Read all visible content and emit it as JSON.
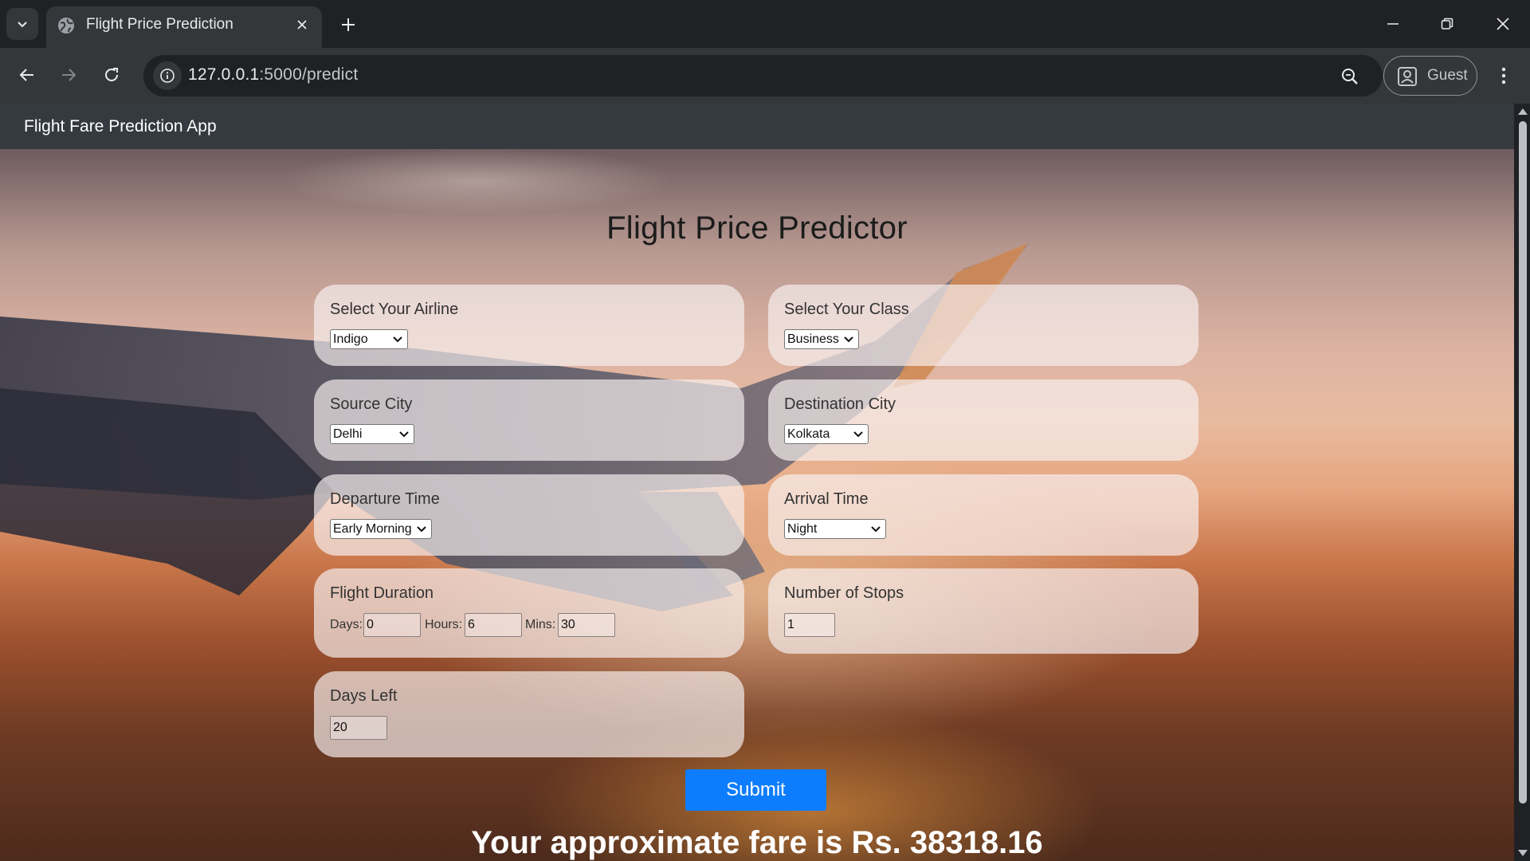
{
  "browser": {
    "tab_title": "Flight Price Prediction",
    "url_host": "127.0.0.1",
    "url_rest": ":5000/predict",
    "profile_label": "Guest"
  },
  "app": {
    "brand": "Flight Fare Prediction App",
    "title": "Flight Price Predictor",
    "fields": {
      "airline": {
        "label": "Select Your Airline",
        "value": "Indigo"
      },
      "class": {
        "label": "Select Your Class",
        "value": "Business"
      },
      "source": {
        "label": "Source City",
        "value": "Delhi"
      },
      "destination": {
        "label": "Destination City",
        "value": "Kolkata"
      },
      "departure": {
        "label": "Departure Time",
        "value": "Early Morning"
      },
      "arrival": {
        "label": "Arrival Time",
        "value": "Night"
      },
      "duration": {
        "label": "Flight Duration",
        "days_label": "Days:",
        "days_value": "0",
        "hours_label": "Hours:",
        "hours_value": "6",
        "mins_label": "Mins:",
        "mins_value": "30"
      },
      "stops": {
        "label": "Number of Stops",
        "value": "1"
      },
      "days_left": {
        "label": "Days Left",
        "value": "20"
      }
    },
    "submit_label": "Submit",
    "result": "Your approximate fare is Rs. 38318.16"
  },
  "colors": {
    "chrome_dark": "#202124",
    "chrome_toolbar": "#35363a",
    "navbar": "#343a40",
    "submit": "#0d7dfd"
  },
  "icons": [
    "tab-search-icon",
    "globe-icon",
    "close-icon",
    "plus-icon",
    "minimize-icon",
    "restore-icon",
    "window-close-icon",
    "back-icon",
    "forward-icon",
    "reload-icon",
    "info-icon",
    "zoom-icon",
    "profile-icon",
    "more-vert-icon",
    "chevron-down-icon"
  ]
}
